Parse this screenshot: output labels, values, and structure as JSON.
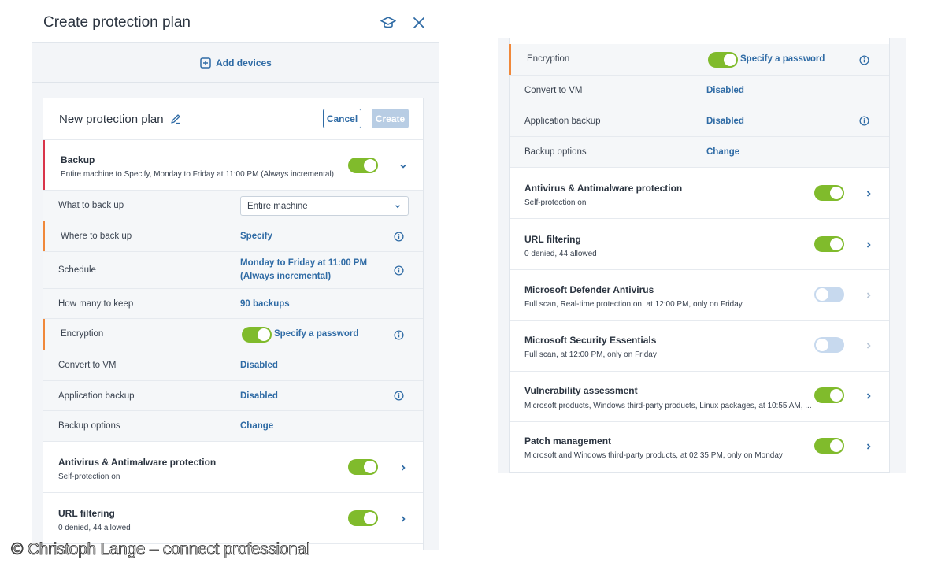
{
  "left": {
    "title": "Create protection plan",
    "add_devices": "Add devices",
    "plan_name": "New protection plan",
    "cancel_label": "Cancel",
    "create_label": "Create",
    "backup": {
      "title": "Backup",
      "subtitle": "Entire machine to Specify, Monday to Friday at 11:00 PM (Always incremental)"
    },
    "rows": {
      "what_label": "What to back up",
      "what_value": "Entire machine",
      "where_label": "Where to back up",
      "where_value": "Specify",
      "schedule_label": "Schedule",
      "schedule_value_1": "Monday to Friday at 11:00 PM",
      "schedule_value_2": "(Always incremental)",
      "keep_label": "How many to keep",
      "keep_value": "90 backups",
      "enc_label": "Encryption",
      "enc_value": "Specify a password",
      "vm_label": "Convert to VM",
      "vm_value": "Disabled",
      "app_label": "Application backup",
      "app_value": "Disabled",
      "opts_label": "Backup options",
      "opts_value": "Change"
    },
    "antivirus": {
      "title": "Antivirus & Antimalware protection",
      "subtitle": "Self-protection on"
    },
    "url": {
      "title": "URL filtering",
      "subtitle": "0 denied, 44 allowed"
    }
  },
  "right": {
    "rows": {
      "enc_label": "Encryption",
      "enc_value": "Specify a password",
      "vm_label": "Convert to VM",
      "vm_value": "Disabled",
      "app_label": "Application backup",
      "app_value": "Disabled",
      "opts_label": "Backup options",
      "opts_value": "Change"
    },
    "sections": [
      {
        "title": "Antivirus & Antimalware protection",
        "subtitle": "Self-protection on",
        "enabled": true
      },
      {
        "title": "URL filtering",
        "subtitle": "0 denied, 44 allowed",
        "enabled": true
      },
      {
        "title": "Microsoft Defender Antivirus",
        "subtitle": "Full scan, Real-time protection on, at 12:00 PM, only on Friday",
        "enabled": false
      },
      {
        "title": "Microsoft Security Essentials",
        "subtitle": "Full scan, at 12:00 PM, only on Friday",
        "enabled": false
      },
      {
        "title": "Vulnerability assessment",
        "subtitle": "Microsoft products, Windows third-party products, Linux packages, at 10:55 AM, ...",
        "enabled": true
      },
      {
        "title": "Patch management",
        "subtitle": "Microsoft and Windows third-party products, at 02:35 PM, only on Monday",
        "enabled": true
      }
    ]
  },
  "credit": "© Christoph Lange – connect professional",
  "colors": {
    "accent": "#2f6ba5",
    "toggle_on": "#80bb2c",
    "toggle_off": "#c7d9ee",
    "marker_orange": "#f0883a",
    "marker_red": "#d9344a"
  },
  "icons": {
    "header": [
      "graduation-cap-icon",
      "close-icon"
    ],
    "add": "plus-square-icon",
    "edit": "pencil-icon",
    "info": "info-icon",
    "chevron": [
      "chevron-down-icon",
      "chevron-right-icon"
    ]
  }
}
